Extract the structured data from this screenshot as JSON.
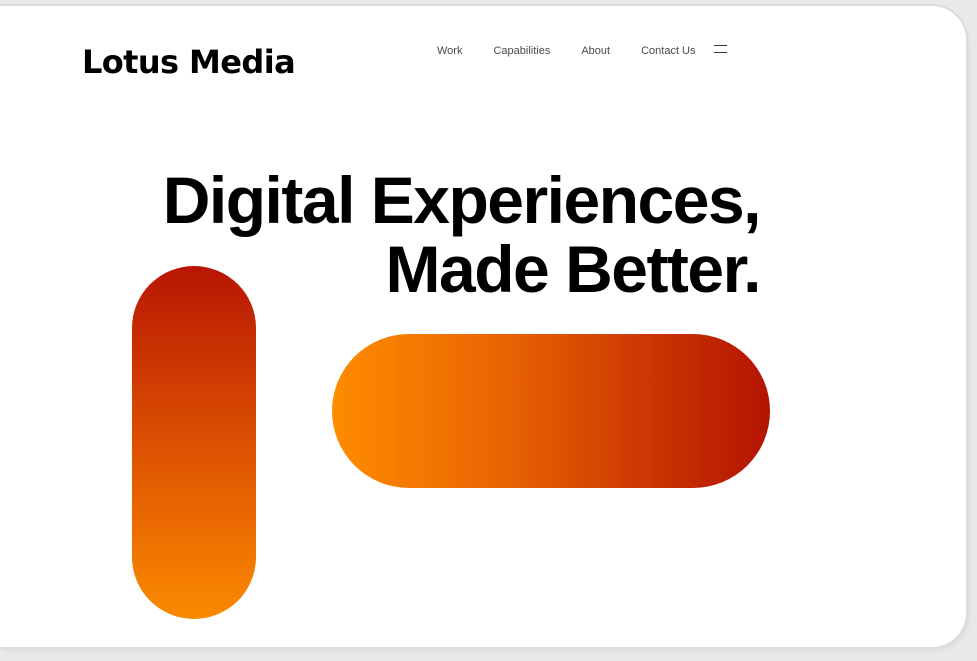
{
  "brand": {
    "name": "Lotus Media"
  },
  "nav": {
    "items": [
      {
        "label": "Work"
      },
      {
        "label": "Capabilities"
      },
      {
        "label": "About"
      },
      {
        "label": "Contact Us"
      }
    ],
    "menu_icon": "hamburger-menu-icon"
  },
  "hero": {
    "line1": "Digital Experiences,",
    "line2": "Made Better."
  },
  "colors": {
    "gradient_dark_red": "#b81502",
    "gradient_orange": "#fb8a00",
    "text": "#000000",
    "nav_text": "#4a4a4a"
  }
}
